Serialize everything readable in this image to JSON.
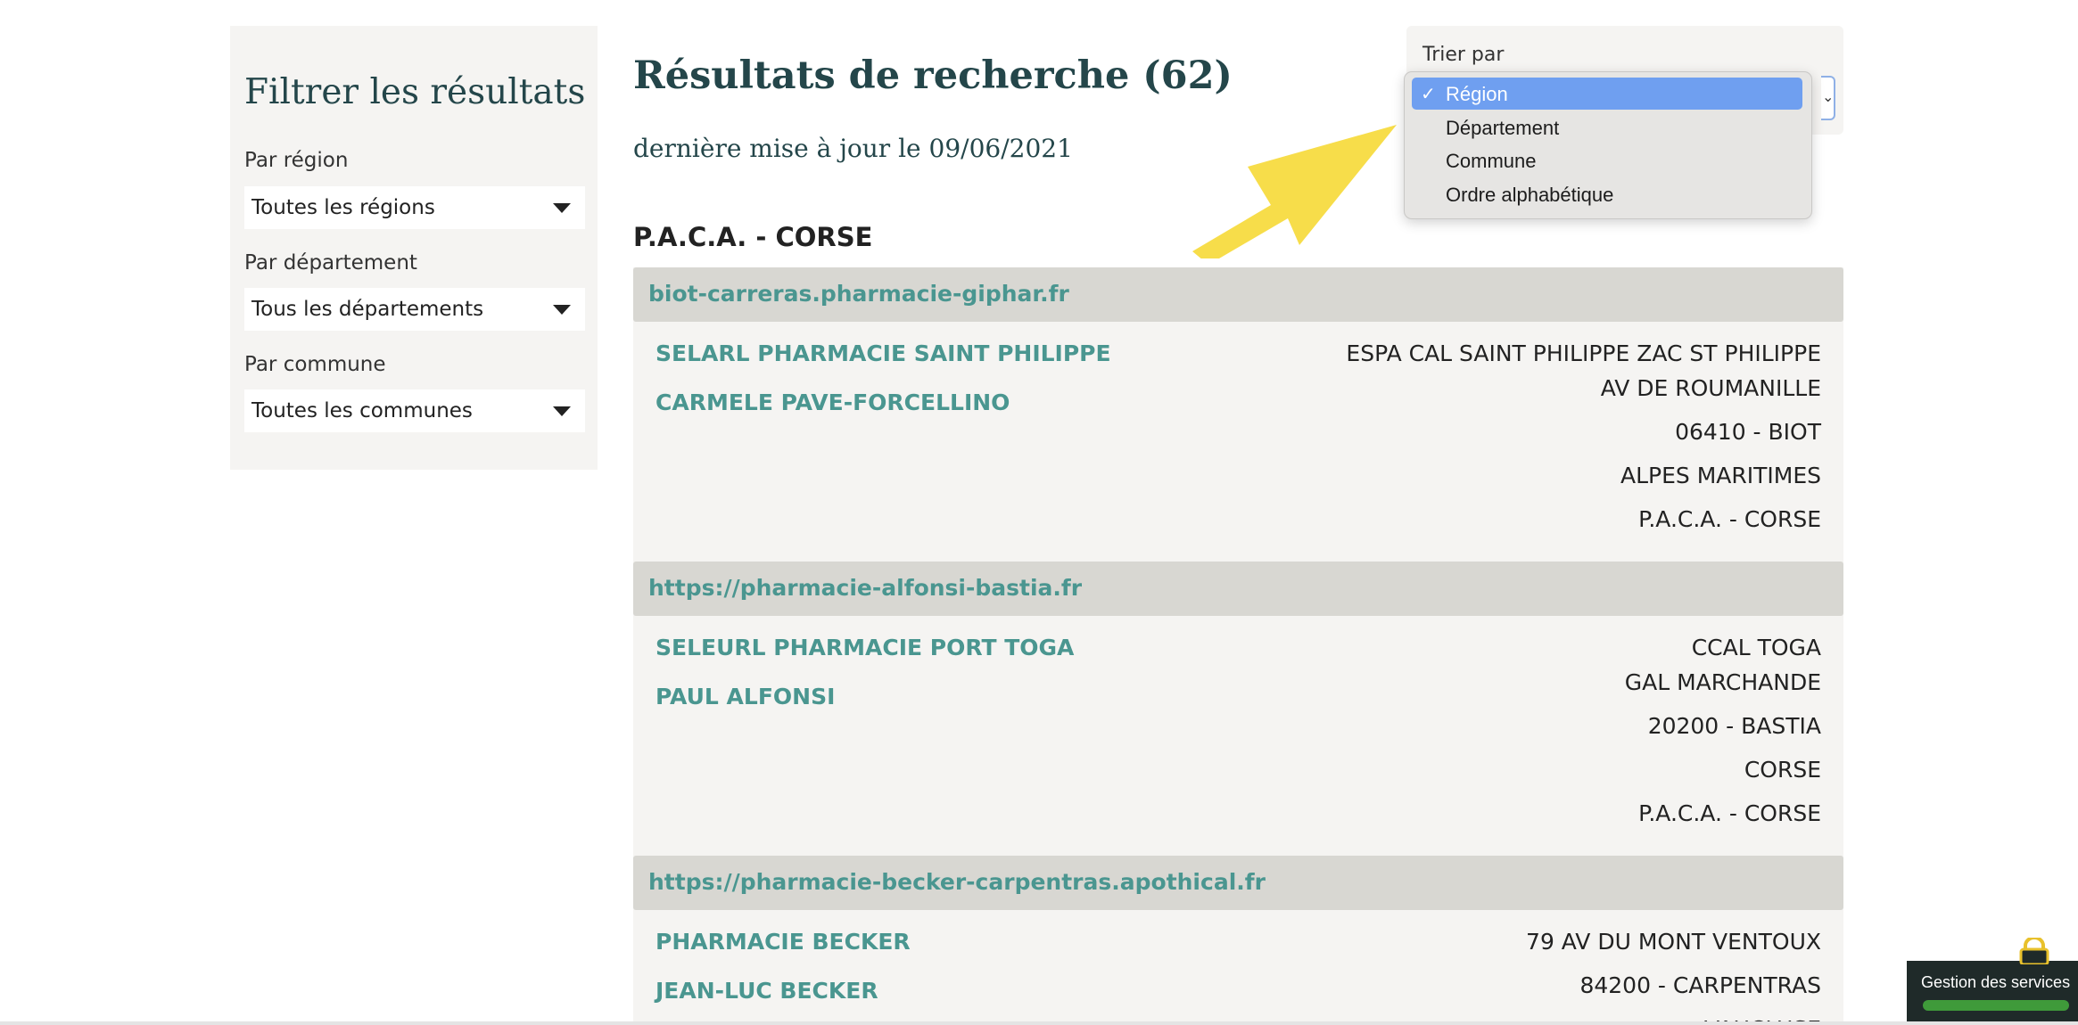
{
  "sidebar": {
    "title": "Filtrer les résultats",
    "filters": [
      {
        "label": "Par région",
        "value": "Toutes les régions"
      },
      {
        "label": "Par département",
        "value": "Tous les départements"
      },
      {
        "label": "Par commune",
        "value": "Toutes les communes"
      }
    ]
  },
  "main": {
    "title": "Résultats de recherche (62)",
    "updated": "dernière mise à jour le 09/06/2021",
    "region_heading": "P.A.C.A. - CORSE",
    "results": [
      {
        "url": "biot-carreras.pharmacie-giphar.fr",
        "name": "SELARL PHARMACIE SAINT PHILIPPE",
        "person": "CARMELE PAVE-FORCELLINO",
        "address": [
          "ESPA CAL SAINT PHILIPPE ZAC ST PHILIPPE",
          "AV DE ROUMANILLE",
          "06410 - BIOT",
          "ALPES MARITIMES",
          "P.A.C.A. - CORSE"
        ]
      },
      {
        "url": "https://pharmacie-alfonsi-bastia.fr",
        "name": "SELEURL PHARMACIE PORT TOGA",
        "person": "PAUL ALFONSI",
        "address": [
          "CCAL TOGA",
          "GAL MARCHANDE",
          "20200 - BASTIA",
          "CORSE",
          "P.A.C.A. - CORSE"
        ]
      },
      {
        "url": "https://pharmacie-becker-carpentras.apothical.fr",
        "name": "PHARMACIE BECKER",
        "person": "JEAN-LUC BECKER",
        "address": [
          "79 AV DU MONT VENTOUX",
          "84200 - CARPENTRAS",
          "VAUCLUSE"
        ]
      }
    ]
  },
  "sort": {
    "label": "Trier par",
    "selected": "Région",
    "options": [
      "Région",
      "Département",
      "Commune",
      "Ordre alphabétique"
    ],
    "check_glyph": "✓"
  },
  "widget": {
    "label": "Gestion des services"
  },
  "colors": {
    "accent": "#4a9690",
    "title": "#24464a",
    "selected_option": "#6f9ff0",
    "arrow": "#f7dd4a"
  }
}
